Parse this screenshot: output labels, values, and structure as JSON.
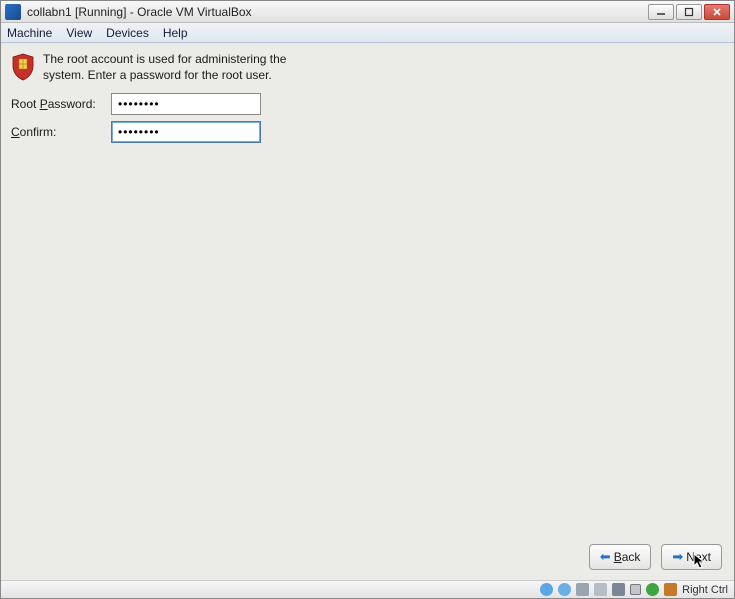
{
  "title": "collabn1 [Running] - Oracle VM VirtualBox",
  "menu": {
    "machine": "Machine",
    "view": "View",
    "devices": "Devices",
    "help": "Help"
  },
  "intro_text": "The root account is used for administering the system.  Enter a password for the root user.",
  "labels": {
    "root_password_pre": "Root ",
    "root_password_u": "P",
    "root_password_post": "assword:",
    "confirm_u": "C",
    "confirm_post": "onfirm:"
  },
  "fields": {
    "root_password": "••••••••",
    "confirm": "••••••••"
  },
  "nav": {
    "back_u": "B",
    "back_post": "ack",
    "next_pre": "N",
    "next_u": "e",
    "next_post": "xt"
  },
  "status": {
    "host_key": "Right Ctrl"
  }
}
